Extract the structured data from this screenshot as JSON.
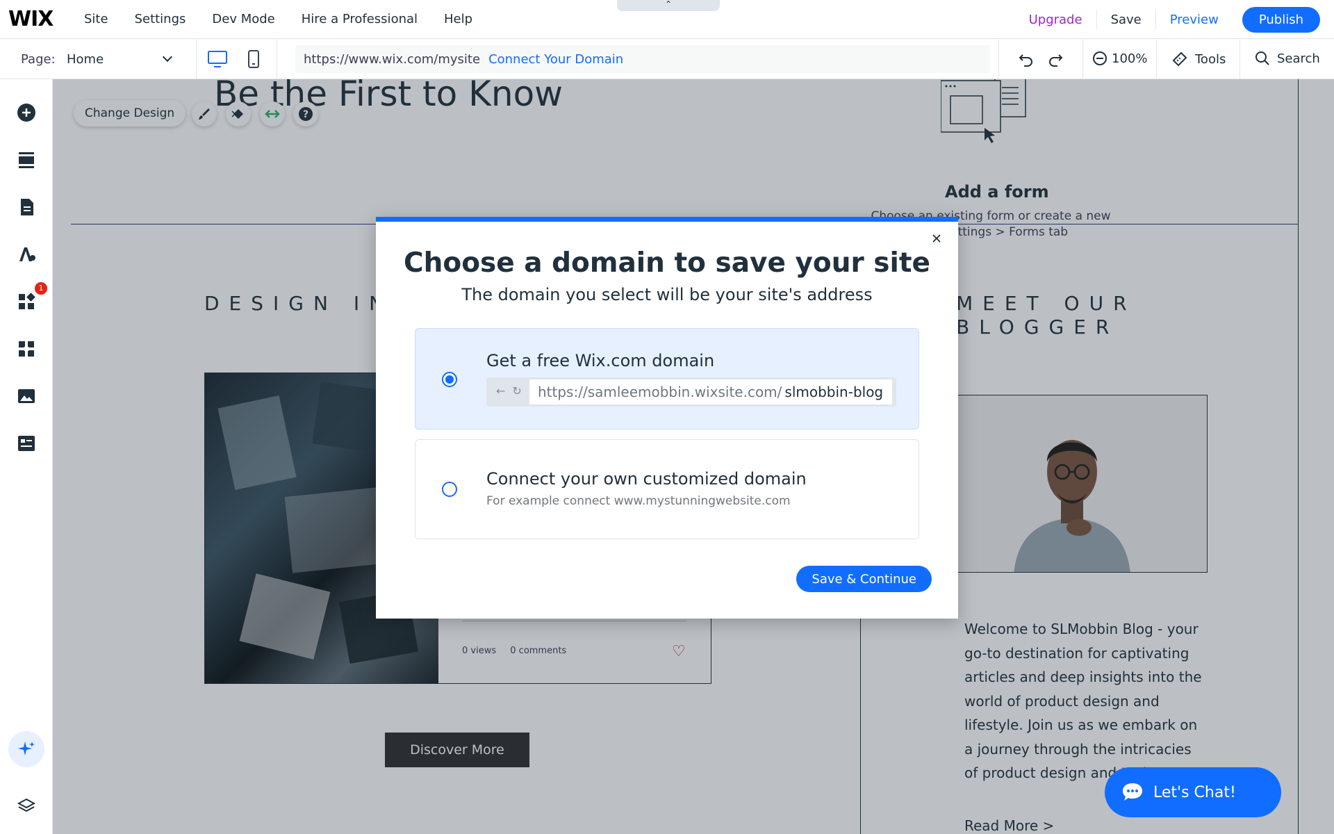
{
  "topbar": {
    "logo": "WIX",
    "menu": [
      "Site",
      "Settings",
      "Dev Mode",
      "Hire a Professional",
      "Help"
    ],
    "upgrade": "Upgrade",
    "save": "Save",
    "preview": "Preview",
    "publish": "Publish"
  },
  "toolbar": {
    "page_label": "Page:",
    "page_value": "Home",
    "url": "https://www.wix.com/mysite",
    "connect_domain": "Connect Your Domain",
    "zoom": "100%",
    "tools": "Tools",
    "search": "Search"
  },
  "leftrail": {
    "badge_count": "1"
  },
  "canvas": {
    "hero_title": "Be the First to Know",
    "change_design": "Change Design",
    "add_form_title": "Add a form",
    "add_form_sub": "Choose an existing form or create a new one. Settings > Forms tab",
    "design_heading": "DESIGN INS",
    "meet_heading_1": "MEET OUR",
    "meet_heading_2": "BLOGGER",
    "views": "0 views",
    "comments": "0 comments",
    "discover_more": "Discover More",
    "welcome_text": "Welcome to SLMobbin Blog - your go-to destination for captivating articles and deep insights into the world of product design and lifestyle. Join us as we embark on a journey through the intricacies of product design and tech",
    "read_more": "Read More >",
    "chat_label": "Let's Chat!"
  },
  "modal": {
    "title": "Choose a domain to save your site",
    "subtitle": "The domain you select will be your site's address",
    "option_free": {
      "title": "Get a free Wix.com domain",
      "base_url": "https://samleemobbin.wixsite.com/",
      "slug": "slmobbin-blog",
      "selected": true
    },
    "option_custom": {
      "title": "Connect your own customized domain",
      "description": "For example connect www.mystunningwebsite.com",
      "selected": false
    },
    "save_continue": "Save & Continue"
  },
  "colors": {
    "accent": "#116dff",
    "upgrade": "#9a27d5",
    "selected_option_bg": "#e7f0ff"
  }
}
